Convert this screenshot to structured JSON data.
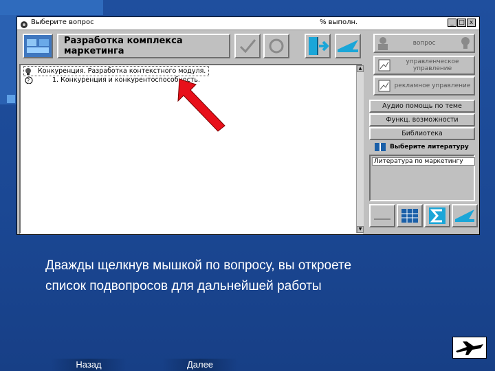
{
  "window": {
    "title": "Выберите вопрос",
    "percent_label": "% выполн.",
    "minimize": "_",
    "maximize": "□",
    "close": "x"
  },
  "header": {
    "title": "Разработка комплекса маркетинга"
  },
  "questions": [
    {
      "text": "Конкуренция. Разработка контекстного модуля."
    },
    {
      "text": "1. Конкуренция и конкурентоспособность."
    }
  ],
  "right_panel": {
    "question_button": "вопрос",
    "buttons": [
      {
        "label": "управленческое управление"
      },
      {
        "label": "рекламное управление"
      }
    ],
    "side_buttons": [
      {
        "label": "Аудио помощь по теме"
      },
      {
        "label": "Функц. возможности"
      },
      {
        "label": "Библиотека"
      }
    ],
    "literature_header": "Выберите литературу",
    "literature_selected": "Литература по маркетингу"
  },
  "caption": {
    "line1": "Дважды щелкнув мышкой по вопросу, вы откроете",
    "line2": "список подвопросов для дальнейшей работы"
  },
  "nav": {
    "back": "Назад",
    "next": "Далее"
  },
  "colors": {
    "slide_bg": "#1b4894",
    "window_face": "#c0c0c0",
    "arrow_red": "#e8101a",
    "tool_cyan": "#1aa6d8"
  }
}
